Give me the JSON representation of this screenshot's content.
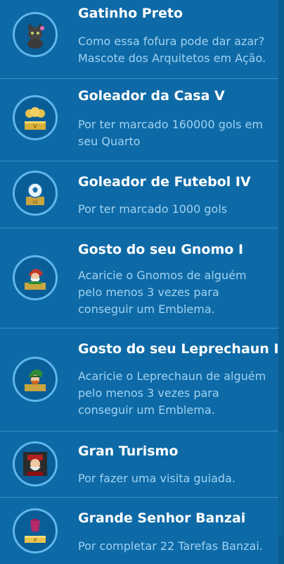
{
  "badges": [
    {
      "title": "Gatinho Preto",
      "description": "Como essa fofura pode dar azar? Mascote dos Arquitetos em Ação.",
      "icon": "black-cat-icon"
    },
    {
      "title": "Goleador da Casa V",
      "description": "Por ter marcado 160000 gols em seu Quarto",
      "icon": "gold-trophy-icon"
    },
    {
      "title": "Goleador de Futebol IV",
      "description": "Por ter marcado 1000 gols",
      "icon": "soccer-ball-trophy-icon"
    },
    {
      "title": "Gosto do seu Gnomo I",
      "description": "Acaricie o Gnomos de alguém pelo menos 3 vezes para conseguir um Emblema.",
      "icon": "gnome-icon"
    },
    {
      "title": "Gosto do seu Leprechaun I",
      "description": "Acaricie o Leprechaun de alguém pelo menos 3 vezes para conseguir um Emblema.",
      "icon": "leprechaun-icon"
    },
    {
      "title": "Gran Turismo",
      "description": "Por fazer uma visita guiada.",
      "icon": "tour-guide-icon"
    },
    {
      "title": "Grande Senhor Banzai",
      "description": "Por completar 22 Tarefas Banzai.",
      "icon": "banzai-trophy-icon"
    }
  ]
}
